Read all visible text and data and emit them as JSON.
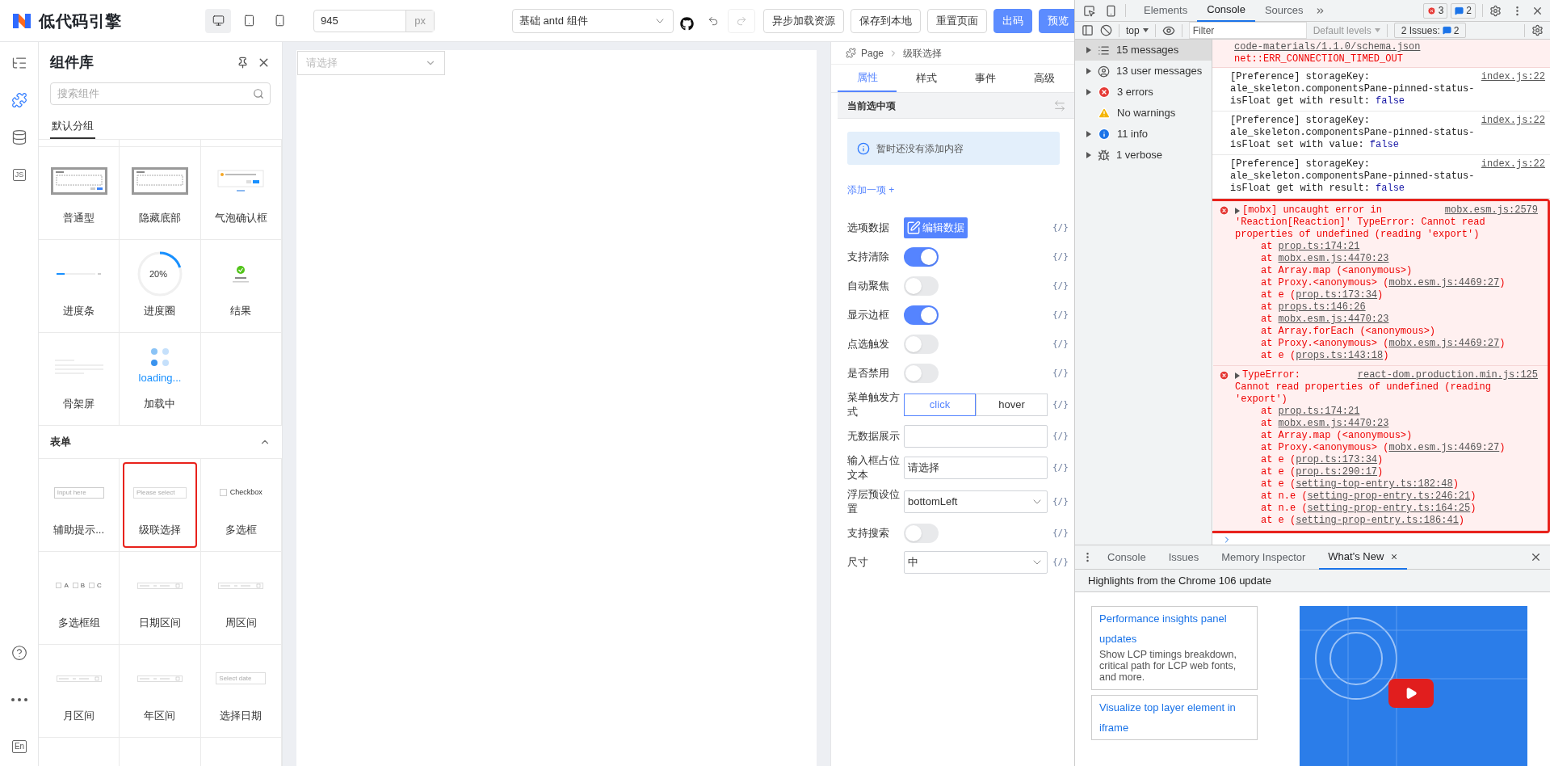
{
  "app": {
    "logo_text": "低代码引擎",
    "devices": [
      {
        "kind": "desktop",
        "selected": true
      },
      {
        "kind": "tablet",
        "selected": false
      },
      {
        "kind": "phone",
        "selected": false
      }
    ],
    "canvas_width": {
      "value": "945",
      "unit": "px"
    },
    "preset_select": {
      "value": "基础 antd 组件"
    },
    "undo": {
      "disabled": false
    },
    "redo": {
      "disabled": true
    },
    "buttons": [
      {
        "label": "异步加载资源",
        "primary": false
      },
      {
        "label": "保存到本地",
        "primary": false
      },
      {
        "label": "重置页面",
        "primary": false
      },
      {
        "label": "出码",
        "primary": true
      },
      {
        "label": "预览",
        "primary": true
      }
    ]
  },
  "rail": {
    "top": [
      {
        "kind": "outline",
        "selected": false
      },
      {
        "kind": "components",
        "selected": true
      },
      {
        "kind": "datasource",
        "selected": false
      },
      {
        "kind": "js",
        "text": "JS",
        "selected": false
      }
    ],
    "bottom": [
      {
        "kind": "help"
      },
      {
        "kind": "more"
      },
      {
        "kind": "lang",
        "text": "En"
      }
    ]
  },
  "components_pane": {
    "title": "组件库",
    "search": {
      "placeholder": "搜索组件"
    },
    "tabs": [
      {
        "label": "默认分组",
        "selected": true
      }
    ],
    "groups": [
      {
        "items": [
          {
            "label": "普通型",
            "kind": "modal",
            "highlighted": false
          },
          {
            "label": "隐藏底部",
            "kind": "modal-nofooter",
            "highlighted": false
          },
          {
            "label": "气泡确认框",
            "kind": "popconfirm",
            "highlighted": false
          },
          {
            "label": "进度条",
            "kind": "progress-bar",
            "highlighted": false
          },
          {
            "label": "进度圈",
            "kind": "progress-circle",
            "preview_text": "20%",
            "highlighted": false
          },
          {
            "label": "结果",
            "kind": "result",
            "highlighted": false
          },
          {
            "label": "骨架屏",
            "kind": "skeleton",
            "highlighted": false
          },
          {
            "label": "加载中",
            "kind": "loading",
            "preview_text": "loading...",
            "highlighted": false
          }
        ]
      },
      {
        "title": "表单",
        "expanded": true,
        "items": [
          {
            "label": "辅助提示...",
            "kind": "input",
            "preview_text": "Input here",
            "highlighted": false
          },
          {
            "label": "级联选择",
            "kind": "cascader",
            "preview_text": "Please select",
            "highlighted": true
          },
          {
            "label": "多选框",
            "kind": "checkbox",
            "preview_text": "Checkbox",
            "highlighted": false
          },
          {
            "label": "多选框组",
            "kind": "checkbox-group",
            "options": [
              "A",
              "B",
              "C"
            ],
            "highlighted": false
          },
          {
            "label": "日期区间",
            "kind": "range",
            "highlighted": false
          },
          {
            "label": "周区间",
            "kind": "range",
            "highlighted": false
          },
          {
            "label": "月区间",
            "kind": "range",
            "highlighted": false
          },
          {
            "label": "年区间",
            "kind": "range",
            "highlighted": false
          },
          {
            "label": "选择日期",
            "kind": "date",
            "preview_text": "Select date",
            "highlighted": false
          }
        ]
      }
    ]
  },
  "canvas": {
    "cascader": {
      "placeholder": "请选择"
    }
  },
  "settings": {
    "breadcrumb": [
      "Page",
      "级联选择"
    ],
    "tabs": [
      {
        "label": "属性",
        "selected": true
      },
      {
        "label": "样式",
        "selected": false
      },
      {
        "label": "事件",
        "selected": false
      },
      {
        "label": "高级",
        "selected": false
      }
    ],
    "section_title": "当前选中项",
    "notice": "暂时还没有添加内容",
    "add_link": "添加一项 +",
    "rows": [
      {
        "label": "选项数据",
        "kind": "button",
        "button": "编辑数据",
        "var": "{/}"
      },
      {
        "label": "支持清除",
        "kind": "switch",
        "on": true,
        "var": "{/}"
      },
      {
        "label": "自动聚焦",
        "kind": "switch",
        "on": false,
        "var": "{/}"
      },
      {
        "label": "显示边框",
        "kind": "switch",
        "on": true,
        "var": "{/}"
      },
      {
        "label": "点选触发",
        "kind": "switch",
        "on": false,
        "var": "{/}"
      },
      {
        "label": "是否禁用",
        "kind": "switch",
        "on": false,
        "var": "{/}"
      },
      {
        "label": "菜单触发方式",
        "kind": "segmented",
        "options": [
          {
            "label": "click",
            "selected": true
          },
          {
            "label": "hover",
            "selected": false
          }
        ],
        "var": "{/}"
      },
      {
        "label": "无数据展示",
        "kind": "input",
        "var": "{/}"
      },
      {
        "label": "输入框占位文本",
        "kind": "input",
        "value": "请选择",
        "var": "{/}"
      },
      {
        "label": "浮层预设位置",
        "kind": "select",
        "value": "bottomLeft",
        "var": "{/}"
      },
      {
        "label": "支持搜索",
        "kind": "switch",
        "on": false,
        "var": "{/}"
      },
      {
        "label": "尺寸",
        "kind": "select",
        "value": "中",
        "var": "{/}"
      }
    ]
  },
  "devtools": {
    "tabs": [
      {
        "label": "Elements",
        "selected": false
      },
      {
        "label": "Console",
        "selected": true
      },
      {
        "label": "Sources",
        "selected": false
      }
    ],
    "error_count": "3",
    "message_count": "2",
    "toolbar": {
      "context": "top",
      "filter": {
        "placeholder": "Filter"
      },
      "levels": "Default levels",
      "issues_label": "2 Issues:",
      "issues_count": "2"
    },
    "sidebar": [
      {
        "label": "15 messages",
        "kind": "list",
        "expandable": true,
        "selected": true
      },
      {
        "label": "13 user messages",
        "kind": "user",
        "expandable": true,
        "selected": false
      },
      {
        "label": "3 errors",
        "kind": "error",
        "expandable": true,
        "selected": false
      },
      {
        "label": "No warnings",
        "kind": "warning",
        "expandable": false,
        "selected": false
      },
      {
        "label": "11 info",
        "kind": "info",
        "expandable": true,
        "selected": false
      },
      {
        "label": "1 verbose",
        "kind": "verbose",
        "expandable": true,
        "selected": false
      }
    ],
    "messages": [
      {
        "kind": "network-error",
        "link": "code-materials/1.1.0/schema.json",
        "lines": [
          "net::ERR_CONNECTION_TIMED_OUT"
        ]
      },
      {
        "kind": "log",
        "lines": [
          "[Preference] storageKey:",
          "ale_skeleton.componentsPane-pinned-status-",
          "isFloat get with result:"
        ],
        "value": "false",
        "source": "index.js:22"
      },
      {
        "kind": "log",
        "lines": [
          "[Preference] storageKey:",
          "ale_skeleton.componentsPane-pinned-status-",
          "isFloat set with value:"
        ],
        "value": "false",
        "source": "index.js:22"
      },
      {
        "kind": "log",
        "lines": [
          "[Preference] storageKey:",
          "ale_skeleton.componentsPane-pinned-status-",
          "isFloat get with result:"
        ],
        "value": "false",
        "source": "index.js:22"
      },
      {
        "kind": "error",
        "highlighted": true,
        "title": "[mobx] uncaught error in",
        "lines": [
          "'Reaction[Reaction]' TypeError: Cannot read",
          "properties of undefined (reading 'export')"
        ],
        "source": "mobx.esm.js:2579",
        "stack": [
          {
            "text": "at ",
            "link": "prop.ts:174:21"
          },
          {
            "text": "at ",
            "link": "mobx.esm.js:4470:23"
          },
          {
            "text": "at Array.map (<anonymous>)"
          },
          {
            "text": "at Proxy.<anonymous> (",
            "link": "mobx.esm.js:4469:27",
            "end": ")"
          },
          {
            "text": "at e (",
            "link": "prop.ts:173:34",
            "end": ")"
          },
          {
            "text": "at ",
            "link": "props.ts:146:26"
          },
          {
            "text": "at ",
            "link": "mobx.esm.js:4470:23"
          },
          {
            "text": "at Array.forEach (<anonymous>)"
          },
          {
            "text": "at Proxy.<anonymous> (",
            "link": "mobx.esm.js:4469:27",
            "end": ")"
          },
          {
            "text": "at e (",
            "link": "props.ts:143:18",
            "end": ")"
          }
        ]
      },
      {
        "kind": "error",
        "highlighted": true,
        "title": "TypeError:",
        "lines": [
          "Cannot read properties of undefined (reading",
          "'export')"
        ],
        "source": "react-dom.production.min.js:125",
        "stack": [
          {
            "text": "at ",
            "link": "prop.ts:174:21"
          },
          {
            "text": "at ",
            "link": "mobx.esm.js:4470:23"
          },
          {
            "text": "at Array.map (<anonymous>)"
          },
          {
            "text": "at Proxy.<anonymous> (",
            "link": "mobx.esm.js:4469:27",
            "end": ")"
          },
          {
            "text": "at e (",
            "link": "prop.ts:173:34",
            "end": ")"
          },
          {
            "text": "at e (",
            "link": "prop.ts:290:17",
            "end": ")"
          },
          {
            "text": "at e (",
            "link": "setting-top-entry.ts:182:48",
            "end": ")"
          },
          {
            "text": "at n.e (",
            "link": "setting-prop-entry.ts:246:21",
            "end": ")"
          },
          {
            "text": "at n.e (",
            "link": "setting-prop-entry.ts:164:25",
            "end": ")"
          },
          {
            "text": "at e (",
            "link": "setting-prop-entry.ts:186:41",
            "end": ")"
          }
        ]
      }
    ],
    "drawer": {
      "tabs": [
        {
          "label": "Console",
          "selected": false,
          "closable": false
        },
        {
          "label": "Issues",
          "selected": false,
          "closable": false
        },
        {
          "label": "Memory Inspector",
          "selected": false,
          "closable": false
        },
        {
          "label": "What's New",
          "selected": true,
          "closable": true
        }
      ],
      "heading": "Highlights from the Chrome 106 update",
      "cards": [
        {
          "title": "Performance insights panel updates",
          "text": "Show LCP timings breakdown, critical path for LCP web fonts, and more."
        },
        {
          "title": "Visualize top layer element in iframe"
        }
      ]
    }
  }
}
